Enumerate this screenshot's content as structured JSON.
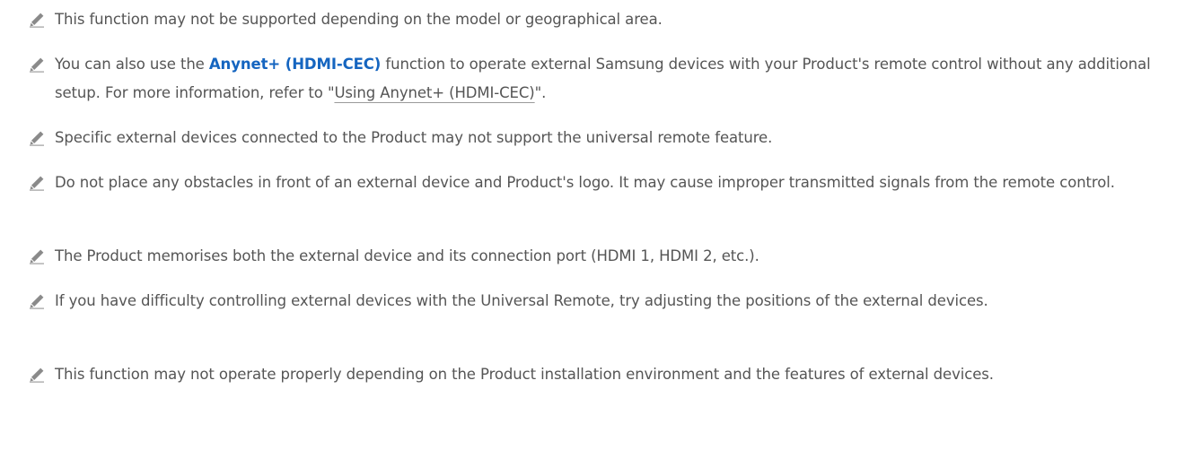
{
  "notes": [
    {
      "icon": "pencil-icon",
      "text": "This function may not be supported depending on the model or geographical area."
    },
    {
      "icon": "pencil-icon",
      "before": "You can also use the ",
      "highlight": "Anynet+ (HDMI-CEC)",
      "after": " function to operate external Samsung devices with your Product's remote control without any additional setup. For more information, refer to \"",
      "link": "Using Anynet+ (HDMI-CEC)",
      "end": "\"."
    },
    {
      "icon": "pencil-icon",
      "text": "Specific external devices connected to the Product may not support the universal remote feature."
    },
    {
      "icon": "pencil-icon",
      "text": "Do not place any obstacles in front of an external device and Product's logo. It may cause improper transmitted signals from the remote control."
    },
    {
      "icon": "pencil-icon",
      "text": "The Product memorises both the external device and its connection port (HDMI 1, HDMI 2, etc.)."
    },
    {
      "icon": "pencil-icon",
      "text": "If you have difficulty controlling external devices with the Universal Remote, try adjusting the positions of the external devices."
    },
    {
      "icon": "pencil-icon",
      "text": "This function may not operate properly depending on the Product installation environment and the features of external devices."
    }
  ],
  "colors": {
    "text": "#555555",
    "highlight": "#1565c0",
    "icon": "#8a8a8a"
  }
}
